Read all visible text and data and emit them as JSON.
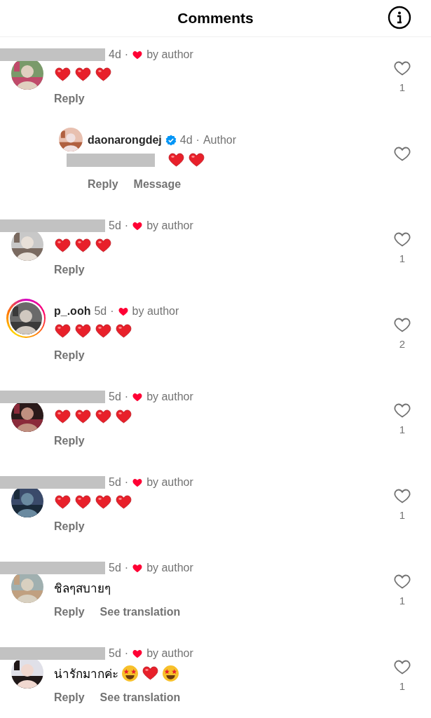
{
  "header": {
    "title": "Comments"
  },
  "comments": [
    {
      "redacted": true,
      "time": "4d",
      "separator": "·",
      "liked_by_author": true,
      "liked_label": "by author",
      "story_ring": false,
      "body": [
        {
          "kind": "heart"
        },
        {
          "kind": "heart"
        },
        {
          "kind": "heart"
        }
      ],
      "actions": [
        "Reply"
      ],
      "like_count": "1",
      "replies": [
        {
          "username": "daonarongdej",
          "verified": true,
          "time": "4d",
          "separator": "·",
          "badge": "Author",
          "body": [
            {
              "kind": "redacted"
            },
            {
              "kind": "heart"
            },
            {
              "kind": "heart"
            }
          ],
          "actions": [
            "Reply",
            "Message"
          ]
        }
      ]
    },
    {
      "redacted": true,
      "time": "5d",
      "separator": "·",
      "liked_by_author": true,
      "liked_label": "by author",
      "story_ring": false,
      "body": [
        {
          "kind": "heart"
        },
        {
          "kind": "heart"
        },
        {
          "kind": "heart"
        }
      ],
      "actions": [
        "Reply"
      ],
      "like_count": "1"
    },
    {
      "username": "p_.ooh",
      "time": "5d",
      "separator": "·",
      "liked_by_author": true,
      "liked_label": "by author",
      "story_ring": true,
      "body": [
        {
          "kind": "heart"
        },
        {
          "kind": "heart"
        },
        {
          "kind": "heart"
        },
        {
          "kind": "heart"
        }
      ],
      "actions": [
        "Reply"
      ],
      "like_count": "2"
    },
    {
      "redacted": true,
      "time": "5d",
      "separator": "·",
      "liked_by_author": true,
      "liked_label": "by author",
      "story_ring": false,
      "body": [
        {
          "kind": "heart"
        },
        {
          "kind": "heart"
        },
        {
          "kind": "heart"
        },
        {
          "kind": "heart"
        }
      ],
      "actions": [
        "Reply"
      ],
      "like_count": "1"
    },
    {
      "redacted": true,
      "time": "5d",
      "separator": "·",
      "liked_by_author": true,
      "liked_label": "by author",
      "story_ring": false,
      "body": [
        {
          "kind": "heart"
        },
        {
          "kind": "heart"
        },
        {
          "kind": "heart"
        },
        {
          "kind": "heart"
        }
      ],
      "actions": [
        "Reply"
      ],
      "like_count": "1"
    },
    {
      "redacted": true,
      "time": "5d",
      "separator": "·",
      "liked_by_author": true,
      "liked_label": "by author",
      "story_ring": false,
      "body": [
        {
          "kind": "text",
          "text": "ชิลๆสบายๆ"
        }
      ],
      "actions": [
        "Reply",
        "See translation"
      ],
      "like_count": "1"
    },
    {
      "redacted": true,
      "time": "5d",
      "separator": "·",
      "liked_by_author": true,
      "liked_label": "by author",
      "story_ring": false,
      "body": [
        {
          "kind": "text",
          "text": "น่ารักมากค่ะ"
        },
        {
          "kind": "starstruck"
        },
        {
          "kind": "heart"
        },
        {
          "kind": "starstruck"
        }
      ],
      "actions": [
        "Reply",
        "See translation"
      ],
      "like_count": "1"
    }
  ]
}
